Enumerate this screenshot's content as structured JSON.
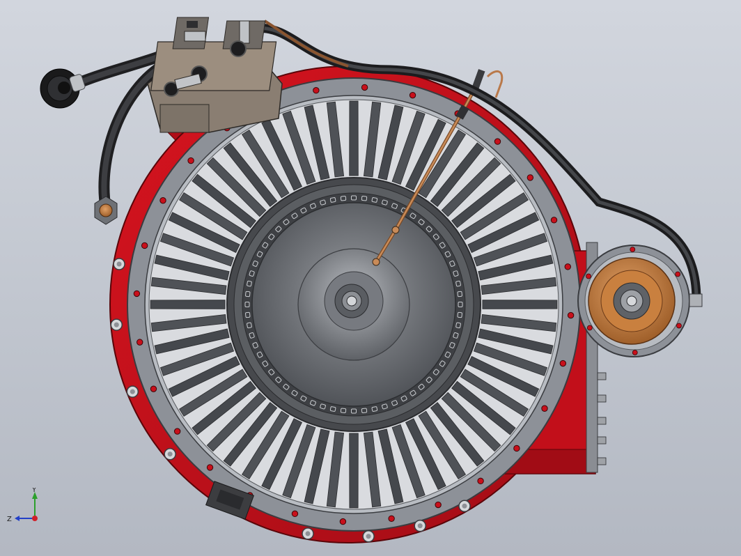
{
  "triad": {
    "x_label": "",
    "y_label": "Y",
    "z_label": "Z"
  },
  "colors": {
    "background": "#c6cbd3",
    "housing_red": "#c8101b",
    "housing_dark": "#8c0a12",
    "ring_gray": "#8d9198",
    "vane_dark": "#4b4e53",
    "rotor_gray": "#6e7175",
    "copper": "#c2834a",
    "hose_black": "#2c2c2e",
    "axis_y": "#2ca02c",
    "axis_z": "#2340c8",
    "axis_x": "#d0202a"
  }
}
